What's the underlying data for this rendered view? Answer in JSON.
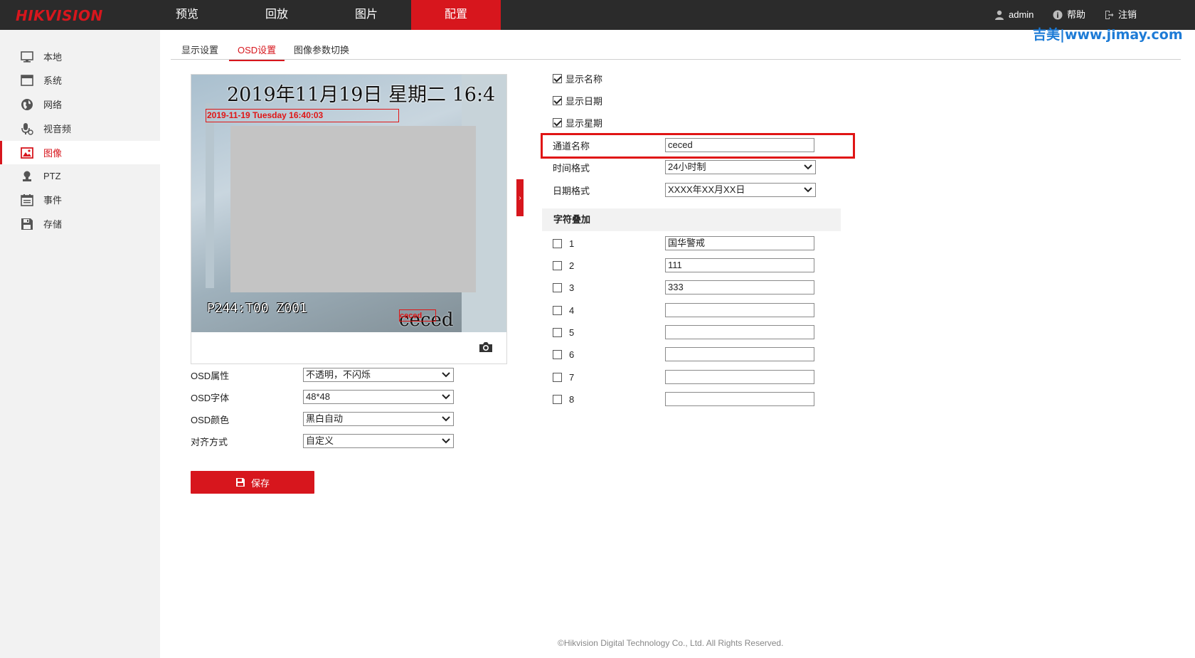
{
  "brand": "HIKVISION",
  "nav": {
    "items": [
      {
        "label": "预览"
      },
      {
        "label": "回放"
      },
      {
        "label": "图片"
      },
      {
        "label": "配置"
      }
    ],
    "active": "配置"
  },
  "user": {
    "name": "admin",
    "help": "帮助",
    "logout": "注销"
  },
  "watermark": "吉美|www.jimay.com",
  "sidebar": {
    "items": [
      {
        "label": "本地",
        "icon": "monitor-icon"
      },
      {
        "label": "系统",
        "icon": "window-icon"
      },
      {
        "label": "网络",
        "icon": "globe-icon"
      },
      {
        "label": "视音频",
        "icon": "microphone-icon"
      },
      {
        "label": "图像",
        "icon": "image-icon"
      },
      {
        "label": "PTZ",
        "icon": "ptz-icon"
      },
      {
        "label": "事件",
        "icon": "calendar-icon"
      },
      {
        "label": "存储",
        "icon": "disk-icon"
      }
    ],
    "active": "图像"
  },
  "tabs": [
    {
      "label": "显示设置"
    },
    {
      "label": "OSD设置"
    },
    {
      "label": "图像参数切换"
    }
  ],
  "active_tab": "OSD设置",
  "preview": {
    "osd_datetime": "2019年11月19日 星期二 16:4",
    "osd_datetime_box": "2019-11-19 Tuesday 16:40:03",
    "osd_bottom_text": "P244:T00  Z001",
    "osd_name_box": "ceced",
    "osd_name": "ceced"
  },
  "osd_form": {
    "attr_label": "OSD属性",
    "attr_value": "不透明，不闪烁",
    "font_label": "OSD字体",
    "font_value": "48*48",
    "color_label": "OSD颜色",
    "color_value": "黑白自动",
    "align_label": "对齐方式",
    "align_value": "自定义"
  },
  "save_label": "保存",
  "display": {
    "show_name": "显示名称",
    "show_date": "显示日期",
    "show_week": "显示星期",
    "channel_name_label": "通道名称",
    "channel_name_value": "ceced",
    "time_format_label": "时间格式",
    "time_format_value": "24小时制",
    "date_format_label": "日期格式",
    "date_format_value": "XXXX年XX月XX日"
  },
  "overlay": {
    "title": "字符叠加",
    "rows": [
      {
        "num": "1",
        "value": "国华警戒"
      },
      {
        "num": "2",
        "value": "111"
      },
      {
        "num": "3",
        "value": "333"
      },
      {
        "num": "4",
        "value": ""
      },
      {
        "num": "5",
        "value": ""
      },
      {
        "num": "6",
        "value": ""
      },
      {
        "num": "7",
        "value": ""
      },
      {
        "num": "8",
        "value": ""
      }
    ]
  },
  "footer": "©Hikvision Digital Technology Co., Ltd. All Rights Reserved.",
  "colors": {
    "accent": "#d7161d",
    "topbar": "#2b2b2b",
    "sidebar": "#f2f2f2",
    "watermark": "#1d7bd6"
  }
}
